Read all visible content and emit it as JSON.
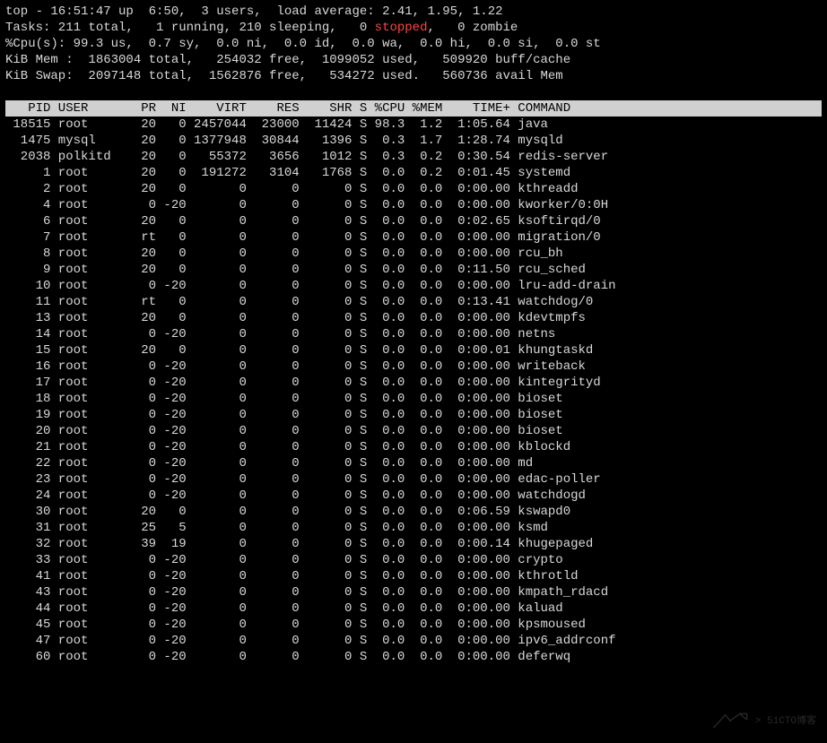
{
  "summary": {
    "line1_prefix": "top - 16:51:47 up  6:50,  3 users,  load average: 2.41, 1.95, 1.22",
    "tasks_a": "Tasks: 211 total,   1 running, 210 sleeping,   0 ",
    "tasks_stopped": "stopped",
    "tasks_b": ",   0 zombie",
    "cpu": "%Cpu(s): 99.3 us,  0.7 sy,  0.0 ni,  0.0 id,  0.0 wa,  0.0 hi,  0.0 si,  0.0 st",
    "mem": "KiB Mem :  1863004 total,   254032 free,  1099052 used,   509920 buff/cache",
    "swap": "KiB Swap:  2097148 total,  1562876 free,   534272 used.   560736 avail Mem"
  },
  "columns": [
    "PID",
    "USER",
    "PR",
    "NI",
    "VIRT",
    "RES",
    "SHR",
    "S",
    "%CPU",
    "%MEM",
    "TIME+",
    "COMMAND"
  ],
  "rows": [
    {
      "pid": "18515",
      "user": "root",
      "pr": "20",
      "ni": "0",
      "virt": "2457044",
      "res": "23000",
      "shr": "11424",
      "s": "S",
      "cpu": "98.3",
      "mem": "1.2",
      "time": "1:05.64",
      "cmd": "java"
    },
    {
      "pid": "1475",
      "user": "mysql",
      "pr": "20",
      "ni": "0",
      "virt": "1377948",
      "res": "30844",
      "shr": "1396",
      "s": "S",
      "cpu": "0.3",
      "mem": "1.7",
      "time": "1:28.74",
      "cmd": "mysqld"
    },
    {
      "pid": "2038",
      "user": "polkitd",
      "pr": "20",
      "ni": "0",
      "virt": "55372",
      "res": "3656",
      "shr": "1012",
      "s": "S",
      "cpu": "0.3",
      "mem": "0.2",
      "time": "0:30.54",
      "cmd": "redis-server"
    },
    {
      "pid": "1",
      "user": "root",
      "pr": "20",
      "ni": "0",
      "virt": "191272",
      "res": "3104",
      "shr": "1768",
      "s": "S",
      "cpu": "0.0",
      "mem": "0.2",
      "time": "0:01.45",
      "cmd": "systemd"
    },
    {
      "pid": "2",
      "user": "root",
      "pr": "20",
      "ni": "0",
      "virt": "0",
      "res": "0",
      "shr": "0",
      "s": "S",
      "cpu": "0.0",
      "mem": "0.0",
      "time": "0:00.00",
      "cmd": "kthreadd"
    },
    {
      "pid": "4",
      "user": "root",
      "pr": "0",
      "ni": "-20",
      "virt": "0",
      "res": "0",
      "shr": "0",
      "s": "S",
      "cpu": "0.0",
      "mem": "0.0",
      "time": "0:00.00",
      "cmd": "kworker/0:0H"
    },
    {
      "pid": "6",
      "user": "root",
      "pr": "20",
      "ni": "0",
      "virt": "0",
      "res": "0",
      "shr": "0",
      "s": "S",
      "cpu": "0.0",
      "mem": "0.0",
      "time": "0:02.65",
      "cmd": "ksoftirqd/0"
    },
    {
      "pid": "7",
      "user": "root",
      "pr": "rt",
      "ni": "0",
      "virt": "0",
      "res": "0",
      "shr": "0",
      "s": "S",
      "cpu": "0.0",
      "mem": "0.0",
      "time": "0:00.00",
      "cmd": "migration/0"
    },
    {
      "pid": "8",
      "user": "root",
      "pr": "20",
      "ni": "0",
      "virt": "0",
      "res": "0",
      "shr": "0",
      "s": "S",
      "cpu": "0.0",
      "mem": "0.0",
      "time": "0:00.00",
      "cmd": "rcu_bh"
    },
    {
      "pid": "9",
      "user": "root",
      "pr": "20",
      "ni": "0",
      "virt": "0",
      "res": "0",
      "shr": "0",
      "s": "S",
      "cpu": "0.0",
      "mem": "0.0",
      "time": "0:11.50",
      "cmd": "rcu_sched"
    },
    {
      "pid": "10",
      "user": "root",
      "pr": "0",
      "ni": "-20",
      "virt": "0",
      "res": "0",
      "shr": "0",
      "s": "S",
      "cpu": "0.0",
      "mem": "0.0",
      "time": "0:00.00",
      "cmd": "lru-add-drain"
    },
    {
      "pid": "11",
      "user": "root",
      "pr": "rt",
      "ni": "0",
      "virt": "0",
      "res": "0",
      "shr": "0",
      "s": "S",
      "cpu": "0.0",
      "mem": "0.0",
      "time": "0:13.41",
      "cmd": "watchdog/0"
    },
    {
      "pid": "13",
      "user": "root",
      "pr": "20",
      "ni": "0",
      "virt": "0",
      "res": "0",
      "shr": "0",
      "s": "S",
      "cpu": "0.0",
      "mem": "0.0",
      "time": "0:00.00",
      "cmd": "kdevtmpfs"
    },
    {
      "pid": "14",
      "user": "root",
      "pr": "0",
      "ni": "-20",
      "virt": "0",
      "res": "0",
      "shr": "0",
      "s": "S",
      "cpu": "0.0",
      "mem": "0.0",
      "time": "0:00.00",
      "cmd": "netns"
    },
    {
      "pid": "15",
      "user": "root",
      "pr": "20",
      "ni": "0",
      "virt": "0",
      "res": "0",
      "shr": "0",
      "s": "S",
      "cpu": "0.0",
      "mem": "0.0",
      "time": "0:00.01",
      "cmd": "khungtaskd"
    },
    {
      "pid": "16",
      "user": "root",
      "pr": "0",
      "ni": "-20",
      "virt": "0",
      "res": "0",
      "shr": "0",
      "s": "S",
      "cpu": "0.0",
      "mem": "0.0",
      "time": "0:00.00",
      "cmd": "writeback"
    },
    {
      "pid": "17",
      "user": "root",
      "pr": "0",
      "ni": "-20",
      "virt": "0",
      "res": "0",
      "shr": "0",
      "s": "S",
      "cpu": "0.0",
      "mem": "0.0",
      "time": "0:00.00",
      "cmd": "kintegrityd"
    },
    {
      "pid": "18",
      "user": "root",
      "pr": "0",
      "ni": "-20",
      "virt": "0",
      "res": "0",
      "shr": "0",
      "s": "S",
      "cpu": "0.0",
      "mem": "0.0",
      "time": "0:00.00",
      "cmd": "bioset"
    },
    {
      "pid": "19",
      "user": "root",
      "pr": "0",
      "ni": "-20",
      "virt": "0",
      "res": "0",
      "shr": "0",
      "s": "S",
      "cpu": "0.0",
      "mem": "0.0",
      "time": "0:00.00",
      "cmd": "bioset"
    },
    {
      "pid": "20",
      "user": "root",
      "pr": "0",
      "ni": "-20",
      "virt": "0",
      "res": "0",
      "shr": "0",
      "s": "S",
      "cpu": "0.0",
      "mem": "0.0",
      "time": "0:00.00",
      "cmd": "bioset"
    },
    {
      "pid": "21",
      "user": "root",
      "pr": "0",
      "ni": "-20",
      "virt": "0",
      "res": "0",
      "shr": "0",
      "s": "S",
      "cpu": "0.0",
      "mem": "0.0",
      "time": "0:00.00",
      "cmd": "kblockd"
    },
    {
      "pid": "22",
      "user": "root",
      "pr": "0",
      "ni": "-20",
      "virt": "0",
      "res": "0",
      "shr": "0",
      "s": "S",
      "cpu": "0.0",
      "mem": "0.0",
      "time": "0:00.00",
      "cmd": "md"
    },
    {
      "pid": "23",
      "user": "root",
      "pr": "0",
      "ni": "-20",
      "virt": "0",
      "res": "0",
      "shr": "0",
      "s": "S",
      "cpu": "0.0",
      "mem": "0.0",
      "time": "0:00.00",
      "cmd": "edac-poller"
    },
    {
      "pid": "24",
      "user": "root",
      "pr": "0",
      "ni": "-20",
      "virt": "0",
      "res": "0",
      "shr": "0",
      "s": "S",
      "cpu": "0.0",
      "mem": "0.0",
      "time": "0:00.00",
      "cmd": "watchdogd"
    },
    {
      "pid": "30",
      "user": "root",
      "pr": "20",
      "ni": "0",
      "virt": "0",
      "res": "0",
      "shr": "0",
      "s": "S",
      "cpu": "0.0",
      "mem": "0.0",
      "time": "0:06.59",
      "cmd": "kswapd0"
    },
    {
      "pid": "31",
      "user": "root",
      "pr": "25",
      "ni": "5",
      "virt": "0",
      "res": "0",
      "shr": "0",
      "s": "S",
      "cpu": "0.0",
      "mem": "0.0",
      "time": "0:00.00",
      "cmd": "ksmd"
    },
    {
      "pid": "32",
      "user": "root",
      "pr": "39",
      "ni": "19",
      "virt": "0",
      "res": "0",
      "shr": "0",
      "s": "S",
      "cpu": "0.0",
      "mem": "0.0",
      "time": "0:00.14",
      "cmd": "khugepaged"
    },
    {
      "pid": "33",
      "user": "root",
      "pr": "0",
      "ni": "-20",
      "virt": "0",
      "res": "0",
      "shr": "0",
      "s": "S",
      "cpu": "0.0",
      "mem": "0.0",
      "time": "0:00.00",
      "cmd": "crypto"
    },
    {
      "pid": "41",
      "user": "root",
      "pr": "0",
      "ni": "-20",
      "virt": "0",
      "res": "0",
      "shr": "0",
      "s": "S",
      "cpu": "0.0",
      "mem": "0.0",
      "time": "0:00.00",
      "cmd": "kthrotld"
    },
    {
      "pid": "43",
      "user": "root",
      "pr": "0",
      "ni": "-20",
      "virt": "0",
      "res": "0",
      "shr": "0",
      "s": "S",
      "cpu": "0.0",
      "mem": "0.0",
      "time": "0:00.00",
      "cmd": "kmpath_rdacd"
    },
    {
      "pid": "44",
      "user": "root",
      "pr": "0",
      "ni": "-20",
      "virt": "0",
      "res": "0",
      "shr": "0",
      "s": "S",
      "cpu": "0.0",
      "mem": "0.0",
      "time": "0:00.00",
      "cmd": "kaluad"
    },
    {
      "pid": "45",
      "user": "root",
      "pr": "0",
      "ni": "-20",
      "virt": "0",
      "res": "0",
      "shr": "0",
      "s": "S",
      "cpu": "0.0",
      "mem": "0.0",
      "time": "0:00.00",
      "cmd": "kpsmoused"
    },
    {
      "pid": "47",
      "user": "root",
      "pr": "0",
      "ni": "-20",
      "virt": "0",
      "res": "0",
      "shr": "0",
      "s": "S",
      "cpu": "0.0",
      "mem": "0.0",
      "time": "0:00.00",
      "cmd": "ipv6_addrconf"
    },
    {
      "pid": "60",
      "user": "root",
      "pr": "0",
      "ni": "-20",
      "virt": "0",
      "res": "0",
      "shr": "0",
      "s": "S",
      "cpu": "0.0",
      "mem": "0.0",
      "time": "0:00.00",
      "cmd": "deferwq"
    }
  ],
  "watermark": {
    "text": "> 51CTO博客"
  }
}
